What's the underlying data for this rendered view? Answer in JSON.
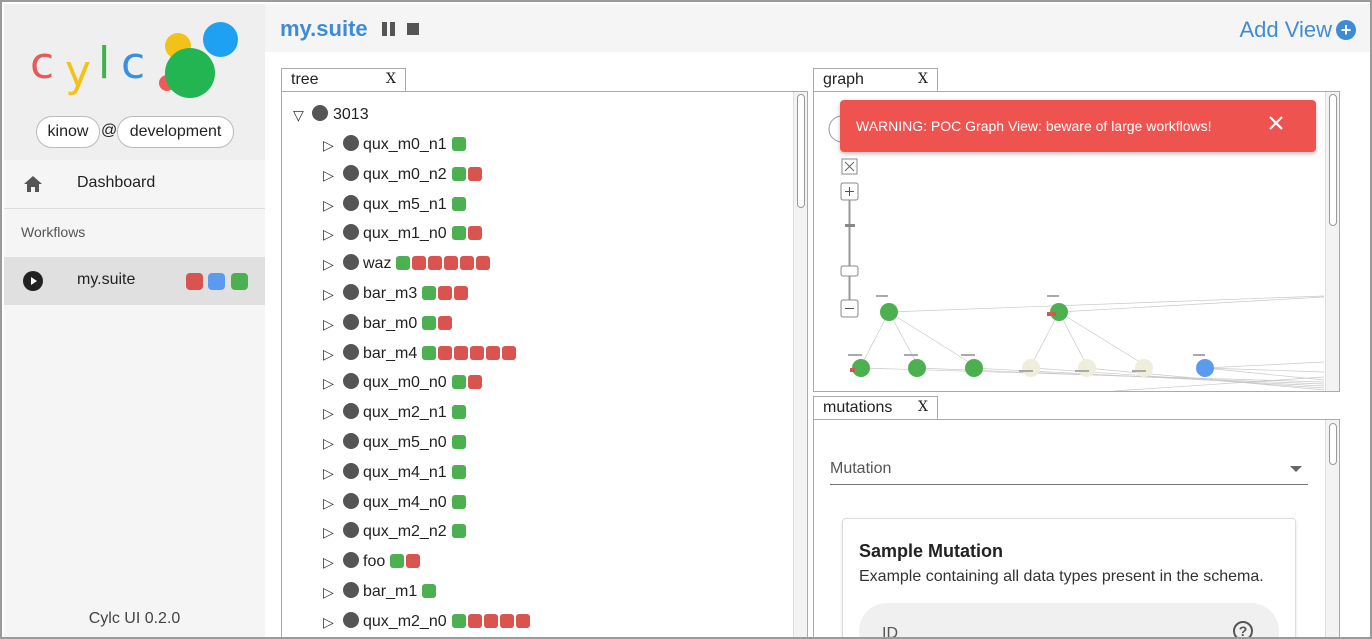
{
  "app": {
    "logo_letters": [
      "c",
      "y",
      "l",
      "c"
    ],
    "user": "kinow",
    "at": "@",
    "host": "development",
    "version": "Cylc UI 0.2.0"
  },
  "sidebar": {
    "dashboard_label": "Dashboard",
    "workflows_label": "Workflows",
    "workflow": {
      "name": "my.suite",
      "state_colors": [
        "#d9534f",
        "#5b9bef",
        "#4caf50"
      ]
    }
  },
  "header": {
    "title": "my.suite",
    "add_view_label": "Add View"
  },
  "views": {
    "tree": {
      "label": "tree",
      "close": "X"
    },
    "graph": {
      "label": "graph",
      "close": "X"
    },
    "mutations": {
      "label": "mutations",
      "close": "X"
    }
  },
  "tree": {
    "root": {
      "toggle": "▽",
      "name": "3013"
    },
    "rows": [
      {
        "name": "qux_m0_n1",
        "jobs": [
          "g"
        ]
      },
      {
        "name": "qux_m0_n2",
        "jobs": [
          "g",
          "r"
        ]
      },
      {
        "name": "qux_m5_n1",
        "jobs": [
          "g"
        ]
      },
      {
        "name": "qux_m1_n0",
        "jobs": [
          "g",
          "r"
        ]
      },
      {
        "name": "waz",
        "jobs": [
          "g",
          "r",
          "r",
          "r",
          "r",
          "r"
        ]
      },
      {
        "name": "bar_m3",
        "jobs": [
          "g",
          "r",
          "r"
        ]
      },
      {
        "name": "bar_m0",
        "jobs": [
          "g",
          "r"
        ]
      },
      {
        "name": "bar_m4",
        "jobs": [
          "g",
          "r",
          "r",
          "r",
          "r",
          "r"
        ]
      },
      {
        "name": "qux_m0_n0",
        "jobs": [
          "g",
          "r"
        ]
      },
      {
        "name": "qux_m2_n1",
        "jobs": [
          "g"
        ]
      },
      {
        "name": "qux_m5_n0",
        "jobs": [
          "g"
        ]
      },
      {
        "name": "qux_m4_n1",
        "jobs": [
          "g"
        ]
      },
      {
        "name": "qux_m4_n0",
        "jobs": [
          "g"
        ]
      },
      {
        "name": "qux_m2_n2",
        "jobs": [
          "g"
        ]
      },
      {
        "name": "foo",
        "jobs": [
          "g",
          "r"
        ]
      },
      {
        "name": "bar_m1",
        "jobs": [
          "g"
        ]
      },
      {
        "name": "qux_m2_n0",
        "jobs": [
          "g",
          "r",
          "r",
          "r",
          "r"
        ]
      }
    ],
    "row_toggle": "▷",
    "job_colors": {
      "g": "#4caf50",
      "r": "#d9534f"
    }
  },
  "graph": {
    "warning_text": "WARNING: POC Graph View: beware of large workflows!"
  },
  "mutations": {
    "select_label": "Mutation",
    "card_title": "Sample Mutation",
    "card_description": "Example containing all data types present in the schema.",
    "id_label": "ID",
    "help_symbol": "?"
  },
  "colors": {
    "accent": "#3f8cd6",
    "warning": "#ef5350",
    "success": "#4caf50",
    "failed": "#d9534f",
    "running": "#5b9bef",
    "waiting": "#efeedb"
  }
}
